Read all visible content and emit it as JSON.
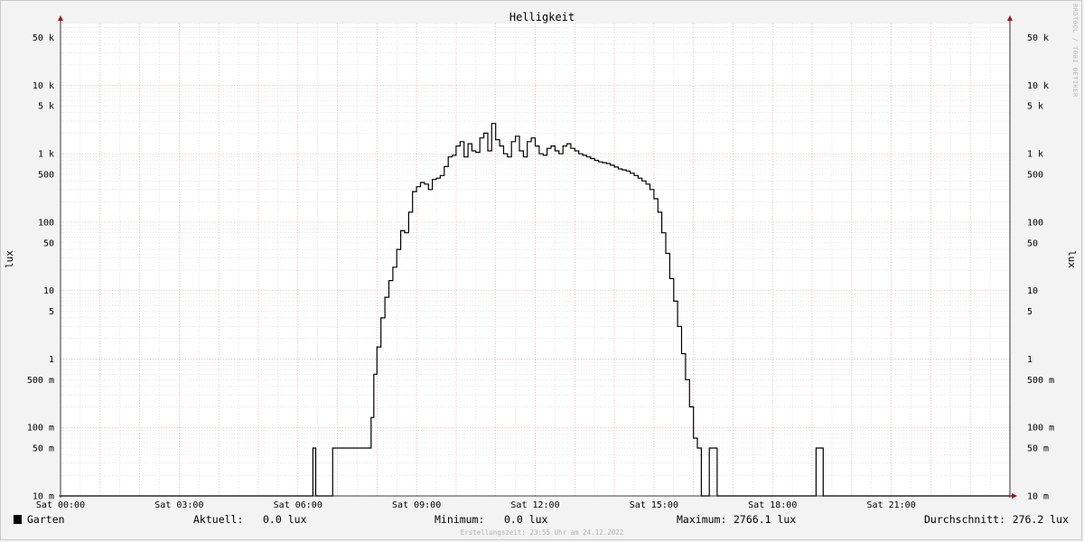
{
  "chart_data": {
    "type": "line",
    "title": "Helligkeit",
    "ylabel": "lux",
    "yscale": "log",
    "ylim": [
      0.01,
      80000
    ],
    "xlim": [
      0,
      24
    ],
    "y_ticks": [
      {
        "value": 50000,
        "label": "50 k"
      },
      {
        "value": 10000,
        "label": "10 k"
      },
      {
        "value": 5000,
        "label": "5 k"
      },
      {
        "value": 1000,
        "label": "1 k"
      },
      {
        "value": 500,
        "label": "500"
      },
      {
        "value": 100,
        "label": "100"
      },
      {
        "value": 50,
        "label": "50"
      },
      {
        "value": 10,
        "label": "10"
      },
      {
        "value": 5,
        "label": "5"
      },
      {
        "value": 1,
        "label": "1"
      },
      {
        "value": 0.5,
        "label": "500 m"
      },
      {
        "value": 0.1,
        "label": "100 m"
      },
      {
        "value": 0.05,
        "label": "50 m"
      },
      {
        "value": 0.01,
        "label": "10 m"
      }
    ],
    "x_ticks": [
      {
        "value": 0,
        "label": "Sat 00:00"
      },
      {
        "value": 3,
        "label": "Sat 03:00"
      },
      {
        "value": 6,
        "label": "Sat 06:00"
      },
      {
        "value": 9,
        "label": "Sat 09:00"
      },
      {
        "value": 12,
        "label": "Sat 12:00"
      },
      {
        "value": 15,
        "label": "Sat 15:00"
      },
      {
        "value": 18,
        "label": "Sat 18:00"
      },
      {
        "value": 21,
        "label": "Sat 21:00"
      }
    ],
    "grid": true,
    "series": [
      {
        "name": "Garten",
        "color": "#000000",
        "x": [
          0,
          6.38,
          6.38,
          6.45,
          6.45,
          6.88,
          6.88,
          7.85,
          7.85,
          7.92,
          8.0,
          8.1,
          8.2,
          8.3,
          8.4,
          8.5,
          8.6,
          8.7,
          8.8,
          8.9,
          9.0,
          9.1,
          9.2,
          9.3,
          9.4,
          9.5,
          9.6,
          9.7,
          9.8,
          9.9,
          10.0,
          10.1,
          10.2,
          10.3,
          10.4,
          10.5,
          10.6,
          10.7,
          10.8,
          10.9,
          11.0,
          11.1,
          11.2,
          11.3,
          11.4,
          11.5,
          11.6,
          11.7,
          11.8,
          11.9,
          12.0,
          12.1,
          12.2,
          12.3,
          12.4,
          12.5,
          12.6,
          12.7,
          12.8,
          12.9,
          13.0,
          13.1,
          13.2,
          13.3,
          13.4,
          13.5,
          13.6,
          13.7,
          13.8,
          13.9,
          14.0,
          14.1,
          14.2,
          14.3,
          14.4,
          14.5,
          14.6,
          14.7,
          14.8,
          14.9,
          15.0,
          15.1,
          15.2,
          15.3,
          15.4,
          15.5,
          15.6,
          15.7,
          15.8,
          15.9,
          16.0,
          16.1,
          16.2,
          16.3,
          16.4,
          16.5,
          16.6,
          16.7,
          16.8,
          16.9,
          17.0,
          17.1,
          17.2,
          17.25,
          17.32,
          17.32,
          19.1,
          19.1,
          19.28,
          19.28,
          24
        ],
        "y": [
          0.01,
          0.01,
          0.05,
          0.05,
          0.01,
          0.01,
          0.05,
          0.05,
          0.14,
          0.6,
          1.5,
          4,
          8,
          14,
          22,
          40,
          75,
          70,
          140,
          280,
          330,
          380,
          360,
          300,
          420,
          440,
          480,
          650,
          900,
          950,
          1300,
          1500,
          900,
          1400,
          1100,
          1050,
          1700,
          2000,
          1100,
          2766,
          1600,
          1300,
          1000,
          900,
          1500,
          1800,
          1100,
          900,
          1500,
          1700,
          1300,
          1000,
          950,
          1200,
          1300,
          1100,
          1000,
          1300,
          1400,
          1200,
          1100,
          1000,
          950,
          900,
          850,
          800,
          760,
          740,
          720,
          680,
          640,
          600,
          580,
          560,
          520,
          480,
          440,
          400,
          360,
          300,
          220,
          140,
          70,
          35,
          15,
          7,
          3,
          1.2,
          0.5,
          0.2,
          0.07,
          0.05,
          0.01,
          0.01,
          0.05,
          0.05,
          0.01,
          0.01,
          0.01,
          0.01,
          0.01,
          0.01,
          0.01,
          0.01,
          0.01,
          0.01,
          0.05,
          0.05,
          0.01,
          0.01,
          0.01
        ],
        "aktuell": "0.0 lux",
        "minimum": "0.0 lux",
        "maximum": "2766.1 lux",
        "durchschnitt": "276.2 lux"
      }
    ]
  },
  "watermark": "RRDTOOL / TOBI OETIKER",
  "legend": {
    "aktuell_label": "Aktuell:",
    "minimum_label": "Minimum:",
    "maximum_label": "Maximum:",
    "durchschnitt_label": "Durchschnitt:"
  },
  "footer": {
    "created": "Erstellungszeit: 23:55 Uhr am 24.12.2022"
  },
  "colors": {
    "background": "#f3f3f3",
    "plot_background": "#ffffff",
    "major_grid": "#e8a0a8",
    "minor_grid": "#d6d6d6",
    "line": "#000000",
    "arrow": "#a01010"
  }
}
